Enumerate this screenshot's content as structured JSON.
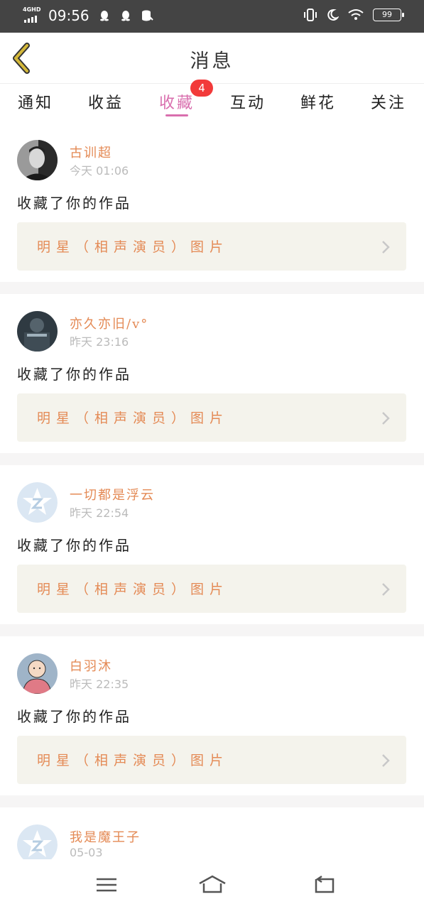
{
  "status_bar": {
    "network": "4GHD",
    "time": "09:56",
    "battery": "99",
    "icons": [
      "qq-icon",
      "qq-icon",
      "database-icon",
      "vibrate-icon",
      "moon-icon",
      "wifi-icon",
      "battery-icon"
    ]
  },
  "header": {
    "title": "消息",
    "back_icon": "chevron-left-icon",
    "accent_color": "#d4b83a"
  },
  "tabs": {
    "items": [
      {
        "label": "通知"
      },
      {
        "label": "收益"
      },
      {
        "label": "收藏",
        "badge": "4",
        "active": true
      },
      {
        "label": "互动"
      },
      {
        "label": "鲜花"
      },
      {
        "label": "关注"
      }
    ],
    "active_color": "#d96fae",
    "badge_color": "#f23a3a"
  },
  "messages": [
    {
      "username": "古训超",
      "time": "今天 01:06",
      "action": "收藏了你的作品",
      "work": "明星（相声演员）图片",
      "avatar": "photo-man"
    },
    {
      "username": "亦久亦旧/v°",
      "time": "昨天 23:16",
      "action": "收藏了你的作品",
      "work": "明星（相声演员）图片",
      "avatar": "photo-dark"
    },
    {
      "username": "一切都是浮云",
      "time": "昨天 22:54",
      "action": "收藏了你的作品",
      "work": "明星（相声演员）图片",
      "avatar": "default-star"
    },
    {
      "username": "白羽沐",
      "time": "昨天 22:35",
      "action": "收藏了你的作品",
      "work": "明星（相声演员）图片",
      "avatar": "cartoon"
    },
    {
      "username": "我是魔王子",
      "time": "05-03",
      "action": "",
      "work": "",
      "avatar": "default-star"
    }
  ],
  "colors": {
    "username": "#e48a55",
    "work_title": "#e48a55",
    "work_bg": "#f4f3ec"
  },
  "nav": {
    "icons": [
      "menu-icon",
      "home-icon",
      "back-icon"
    ]
  }
}
